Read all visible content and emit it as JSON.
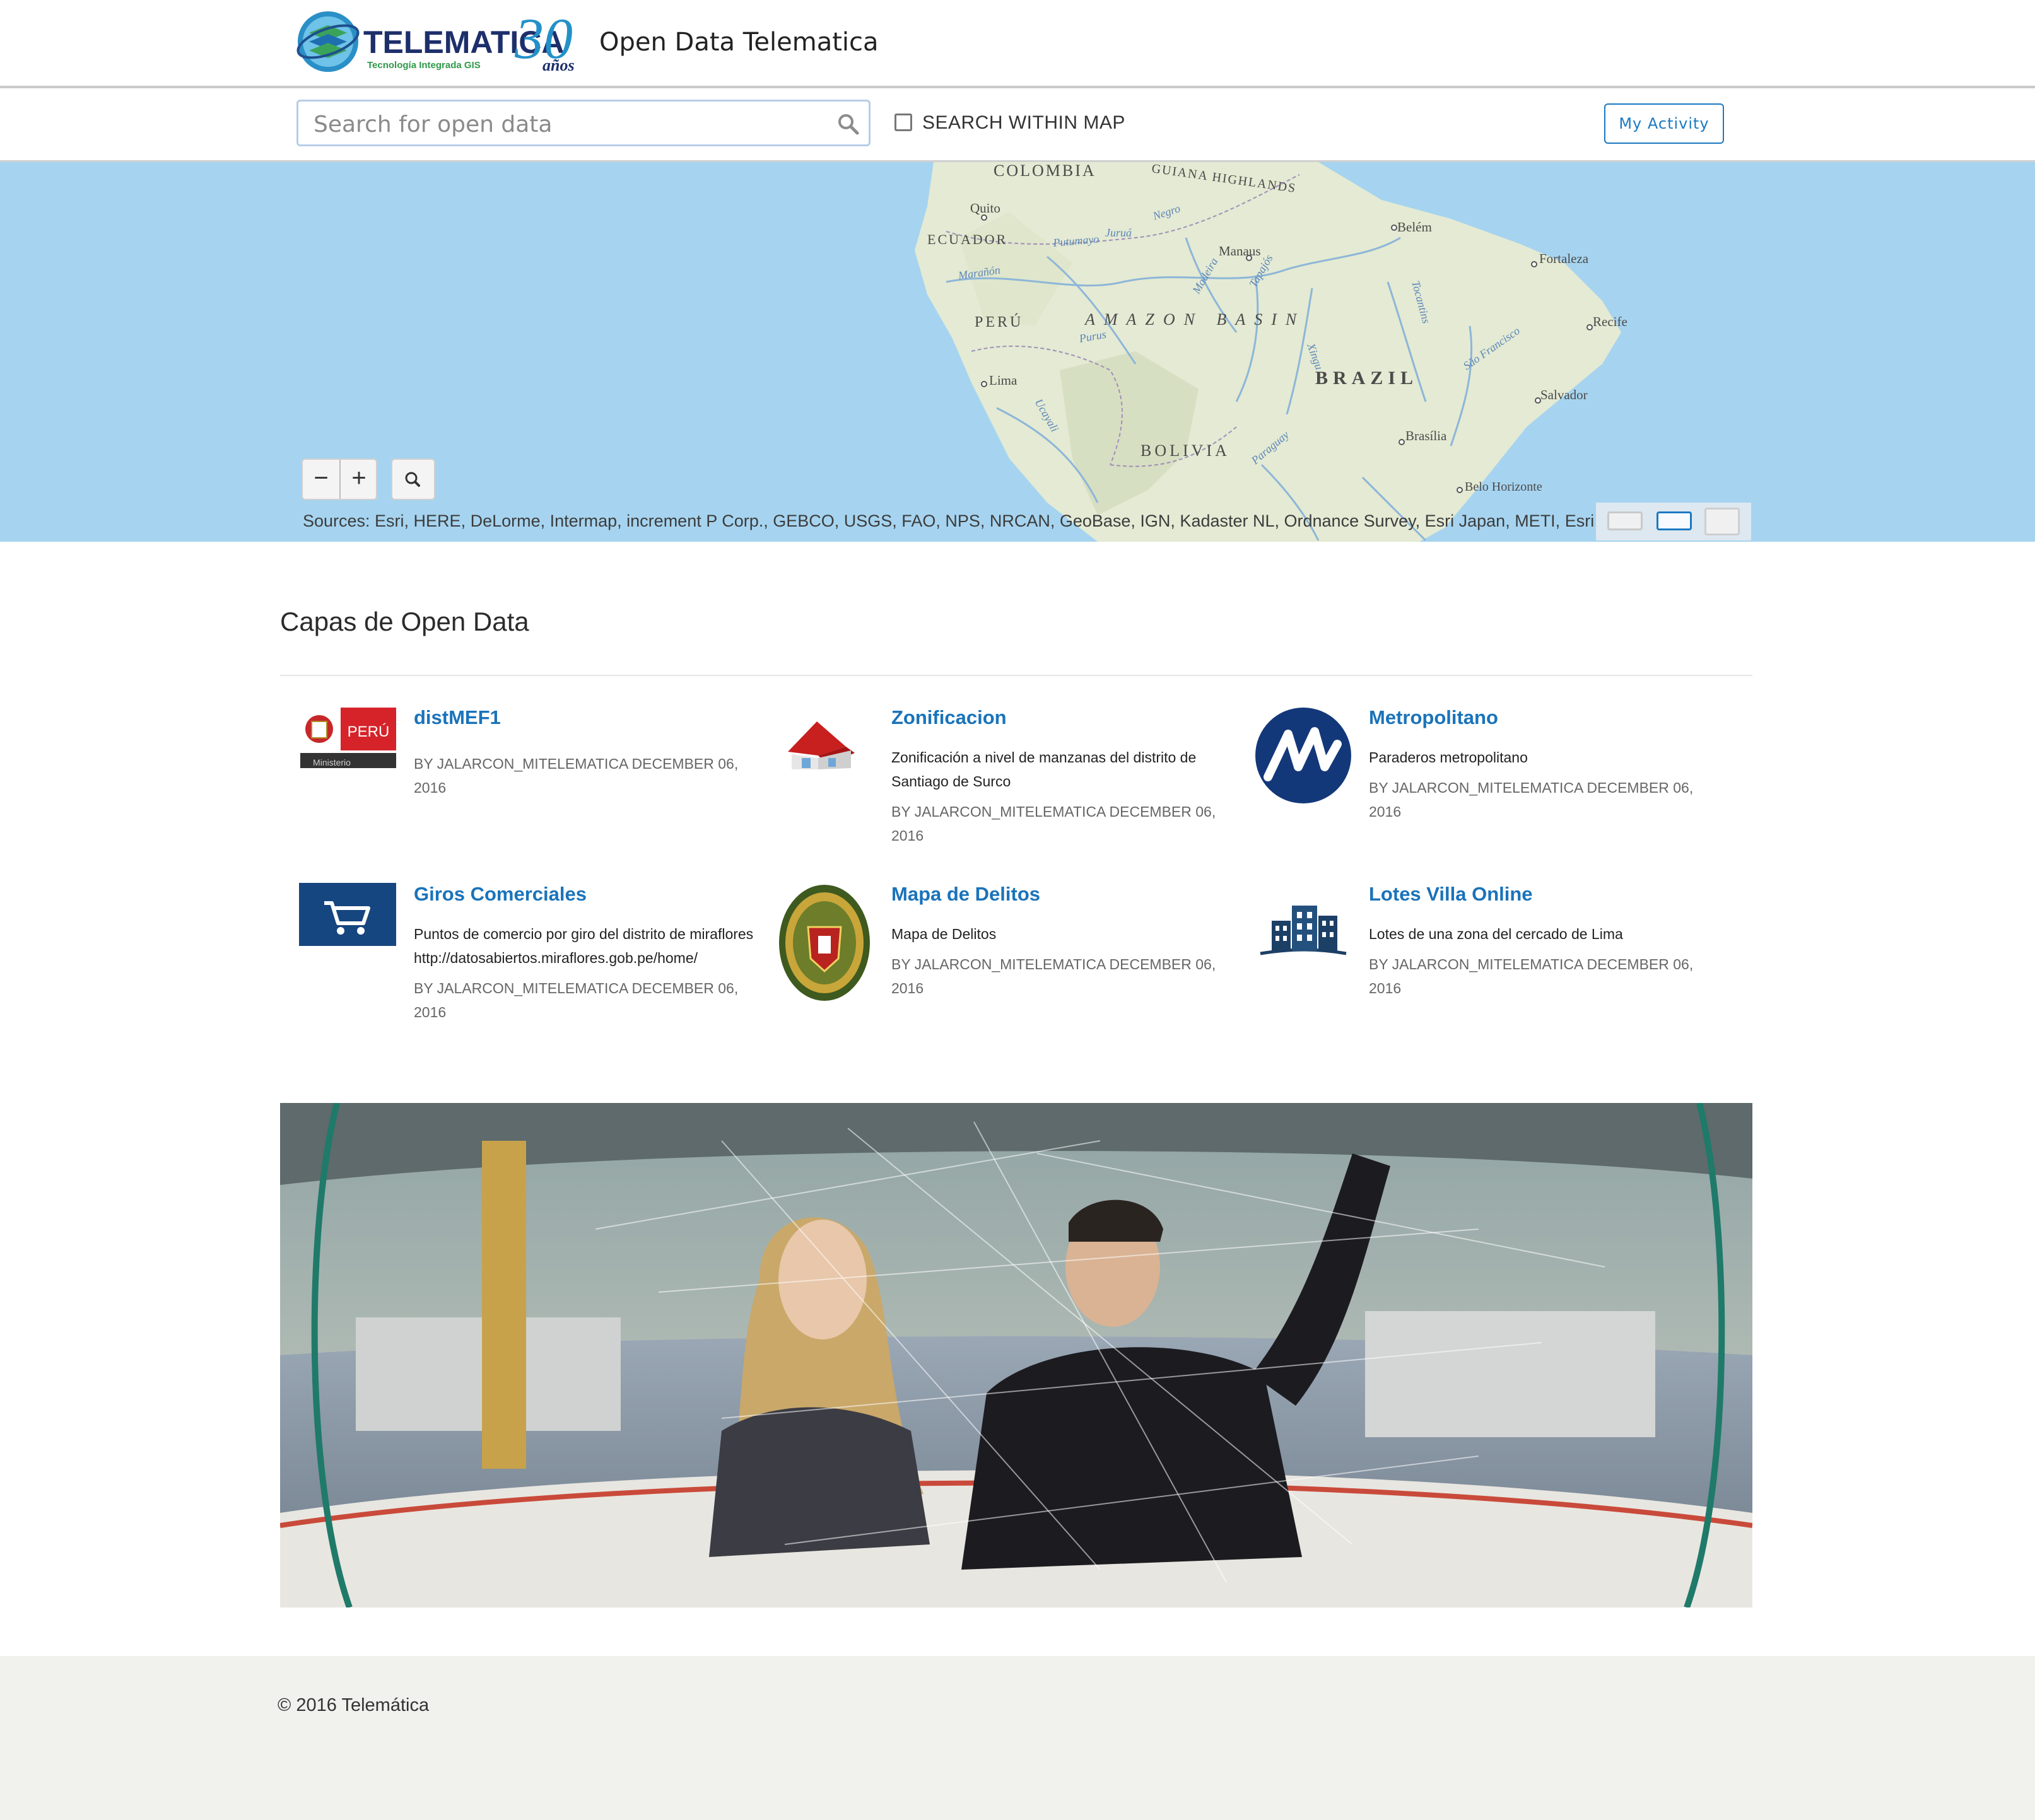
{
  "header": {
    "logo_text": "TELEMATICA",
    "logo_tagline": "Tecnología Integrada GIS",
    "logo_anniversary": "30",
    "logo_years": "años",
    "site_title": "Open Data Telematica"
  },
  "search": {
    "placeholder": "Search for open data",
    "within_map_label": "SEARCH WITHIN MAP",
    "my_activity_label": "My Activity"
  },
  "map": {
    "labels": {
      "colombia": "COLOMBIA",
      "guiana": "GUIANA HIGHLANDS",
      "quito": "Quito",
      "ecuador": "ECUADOR",
      "manaus": "Manaus",
      "belem": "Belém",
      "fortaleza": "Fortaleza",
      "peru": "PERÚ",
      "amazon": "AMAZON BASIN",
      "recife": "Recife",
      "lima": "Lima",
      "brazil": "BRAZIL",
      "salvador": "Salvador",
      "brasilia": "Brasília",
      "bolivia": "BOLIVIA",
      "belo": "Belo Horizonte",
      "negro": "Negro",
      "jurua": "Juruá",
      "putumayo": "Putumayo",
      "maranon": "Marañón",
      "purus": "Purus",
      "madeira": "Madeira",
      "tapajos": "Tapajós",
      "xingu": "Xingu",
      "tocantins": "Tocantins",
      "sao_francisco": "São Francisco",
      "ucayali": "Ucayali",
      "paraguay": "Paraguay"
    },
    "zoom_out": "−",
    "zoom_in": "+",
    "attribution": "Sources: Esri, HERE, DeLorme, Intermap, increment P Corp., GEBCO, USGS, FAO, NPS, NRCAN, GeoBase, IGN, Kadaster NL, Ordnance Survey, Esri Japan, METI, Esri China (Hong Kong), swisstopo, Mapmyindia, © OpenStreetMap contributors, and the GIS User Community"
  },
  "section": {
    "title": "Capas de Open Data"
  },
  "items": [
    {
      "title": "distMEF1",
      "description": "",
      "meta": "BY JALARCON_MITELEMATICA DECEMBER 06, 2016",
      "thumb_text": "PERÚ",
      "thumb_sub": "Ministerio"
    },
    {
      "title": "Zonificacion",
      "description": "Zonificación a nivel de manzanas del distrito de Santiago de Surco",
      "meta": "BY JALARCON_MITELEMATICA DECEMBER 06, 2016"
    },
    {
      "title": "Metropolitano",
      "description": "Paraderos metropolitano",
      "meta": "BY JALARCON_MITELEMATICA DECEMBER 06, 2016"
    },
    {
      "title": "Giros Comerciales",
      "description": "Puntos de comercio por giro del distrito de miraflores http://datosabiertos.miraflores.gob.pe/home/",
      "meta": "BY JALARCON_MITELEMATICA DECEMBER 06, 2016"
    },
    {
      "title": "Mapa de Delitos",
      "description": "Mapa de Delitos",
      "meta": "BY JALARCON_MITELEMATICA DECEMBER 06, 2016"
    },
    {
      "title": "Lotes Villa Online",
      "description": "Lotes de una zona del cercado de Lima",
      "meta": "BY JALARCON_MITELEMATICA DECEMBER 06, 2016"
    }
  ],
  "footer": {
    "copyright": "© 2016 Telemática"
  },
  "colors": {
    "link": "#1a73ba",
    "brand_blue": "#1b79c2",
    "ocean": "#a6d4f0",
    "land": "#e4ead3",
    "footer_bg": "#f1f1ee"
  }
}
